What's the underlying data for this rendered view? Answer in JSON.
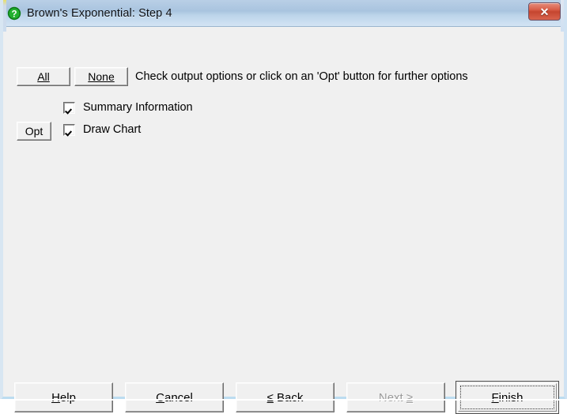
{
  "window": {
    "title": "Brown's Exponential: Step 4",
    "icon": "question-mark-icon",
    "close_label": "✕",
    "accent_titlebar": "#a9c4df",
    "accent_close": "#c5452f",
    "icon_color": "#179c27",
    "body_background": "#f0f0f0"
  },
  "toolbar": {
    "all_label": "All",
    "none_label": "None",
    "hint": "Check output options or click on an 'Opt' button for further options"
  },
  "options": {
    "opt_label": "Opt",
    "items": [
      {
        "label": "Summary Information",
        "checked": true,
        "has_opt": false
      },
      {
        "label": "Draw Chart",
        "checked": true,
        "has_opt": true
      }
    ]
  },
  "footer": {
    "help": {
      "pre": "",
      "accel": "H",
      "post": "elp",
      "enabled": true
    },
    "cancel": {
      "pre": "",
      "accel": "C",
      "post": "ancel",
      "enabled": true
    },
    "back": {
      "pre": "",
      "accel": "≤",
      "post": " Back",
      "enabled": true
    },
    "next": {
      "pre": "Next ",
      "accel": "≥",
      "post": "",
      "enabled": false
    },
    "finish": {
      "pre": "",
      "accel": "F",
      "post": "inish",
      "enabled": true,
      "is_default": true
    }
  }
}
